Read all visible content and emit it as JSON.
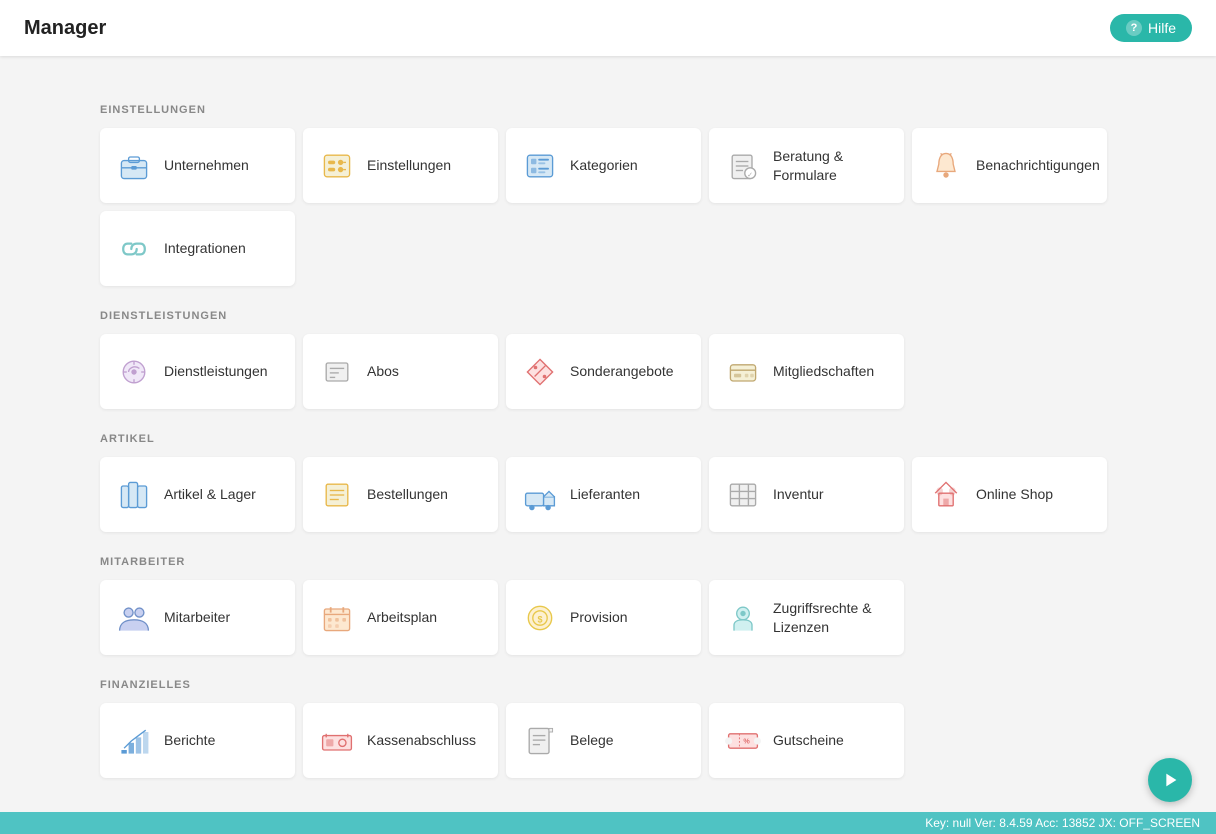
{
  "header": {
    "title": "Manager",
    "help_label": "Hilfe"
  },
  "sections": [
    {
      "id": "einstellungen",
      "label": "EINSTELLUNGEN",
      "cards": [
        {
          "id": "unternehmen",
          "label": "Unternehmen",
          "icon": "briefcase"
        },
        {
          "id": "einstellungen",
          "label": "Einstellungen",
          "icon": "settings"
        },
        {
          "id": "kategorien",
          "label": "Kategorien",
          "icon": "categories"
        },
        {
          "id": "beratung",
          "label": "Beratung & Formulare",
          "icon": "consult"
        },
        {
          "id": "benachrichtigungen",
          "label": "Benachrichtigungen",
          "icon": "bell"
        },
        {
          "id": "integrationen",
          "label": "Integrationen",
          "icon": "link"
        }
      ]
    },
    {
      "id": "dienstleistungen",
      "label": "DIENSTLEISTUNGEN",
      "cards": [
        {
          "id": "dienstleistungen",
          "label": "Dienstleistungen",
          "icon": "services"
        },
        {
          "id": "abos",
          "label": "Abos",
          "icon": "subs"
        },
        {
          "id": "sonderangebote",
          "label": "Sonderangebote",
          "icon": "offers"
        },
        {
          "id": "mitgliedschaften",
          "label": "Mitgliedschaften",
          "icon": "memberships"
        }
      ]
    },
    {
      "id": "artikel",
      "label": "ARTIKEL",
      "cards": [
        {
          "id": "artikel-lager",
          "label": "Artikel & Lager",
          "icon": "articles"
        },
        {
          "id": "bestellungen",
          "label": "Bestellungen",
          "icon": "orders"
        },
        {
          "id": "lieferanten",
          "label": "Lieferanten",
          "icon": "suppliers"
        },
        {
          "id": "inventur",
          "label": "Inventur",
          "icon": "inventory"
        },
        {
          "id": "online-shop",
          "label": "Online Shop",
          "icon": "shop"
        }
      ]
    },
    {
      "id": "mitarbeiter",
      "label": "MITARBEITER",
      "cards": [
        {
          "id": "mitarbeiter",
          "label": "Mitarbeiter",
          "icon": "employees"
        },
        {
          "id": "arbeitsplan",
          "label": "Arbeitsplan",
          "icon": "schedule"
        },
        {
          "id": "provision",
          "label": "Provision",
          "icon": "commission"
        },
        {
          "id": "zugriffsrechte",
          "label": "Zugriffsrechte & Lizenzen",
          "icon": "access"
        }
      ]
    },
    {
      "id": "finanzielles",
      "label": "FINANZIELLES",
      "cards": [
        {
          "id": "berichte",
          "label": "Berichte",
          "icon": "reports"
        },
        {
          "id": "kassenabschluss",
          "label": "Kassenabschluss",
          "icon": "cash"
        },
        {
          "id": "belege",
          "label": "Belege",
          "icon": "receipts"
        },
        {
          "id": "gutscheine",
          "label": "Gutscheine",
          "icon": "vouchers"
        }
      ]
    }
  ],
  "status_bar": "Key: null Ver: 8.4.59  Acc: 13852  JX: OFF_SCREEN"
}
